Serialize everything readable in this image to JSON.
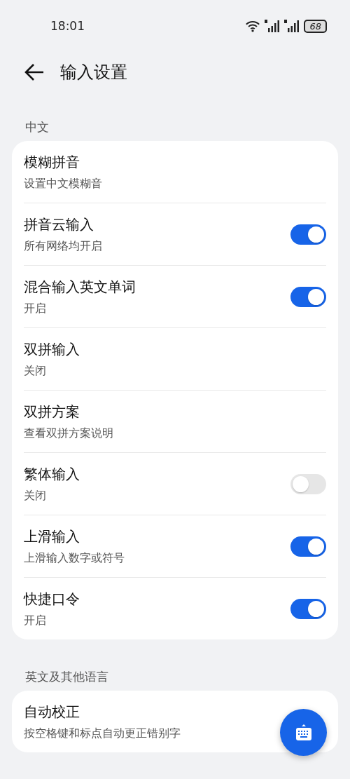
{
  "status_bar": {
    "time": "18:01",
    "battery": "68"
  },
  "header": {
    "title": "输入设置"
  },
  "sections": [
    {
      "title": "中文",
      "items": [
        {
          "kind": "plain",
          "title": "模糊拼音",
          "subtitle": "设置中文模糊音"
        },
        {
          "kind": "toggle",
          "title": "拼音云输入",
          "subtitle": "所有网络均开启",
          "on": true
        },
        {
          "kind": "toggle",
          "title": "混合输入英文单词",
          "subtitle": "开启",
          "on": true
        },
        {
          "kind": "plain",
          "title": "双拼输入",
          "subtitle": "关闭"
        },
        {
          "kind": "plain",
          "title": "双拼方案",
          "subtitle": "查看双拼方案说明"
        },
        {
          "kind": "toggle",
          "title": "繁体输入",
          "subtitle": "关闭",
          "on": false
        },
        {
          "kind": "toggle",
          "title": "上滑输入",
          "subtitle": "上滑输入数字或符号",
          "on": true
        },
        {
          "kind": "toggle",
          "title": "快捷口令",
          "subtitle": "开启",
          "on": true
        }
      ]
    },
    {
      "title": "英文及其他语言",
      "items": [
        {
          "kind": "plain",
          "title": "自动校正",
          "subtitle": "按空格键和标点自动更正错别字"
        }
      ]
    }
  ]
}
